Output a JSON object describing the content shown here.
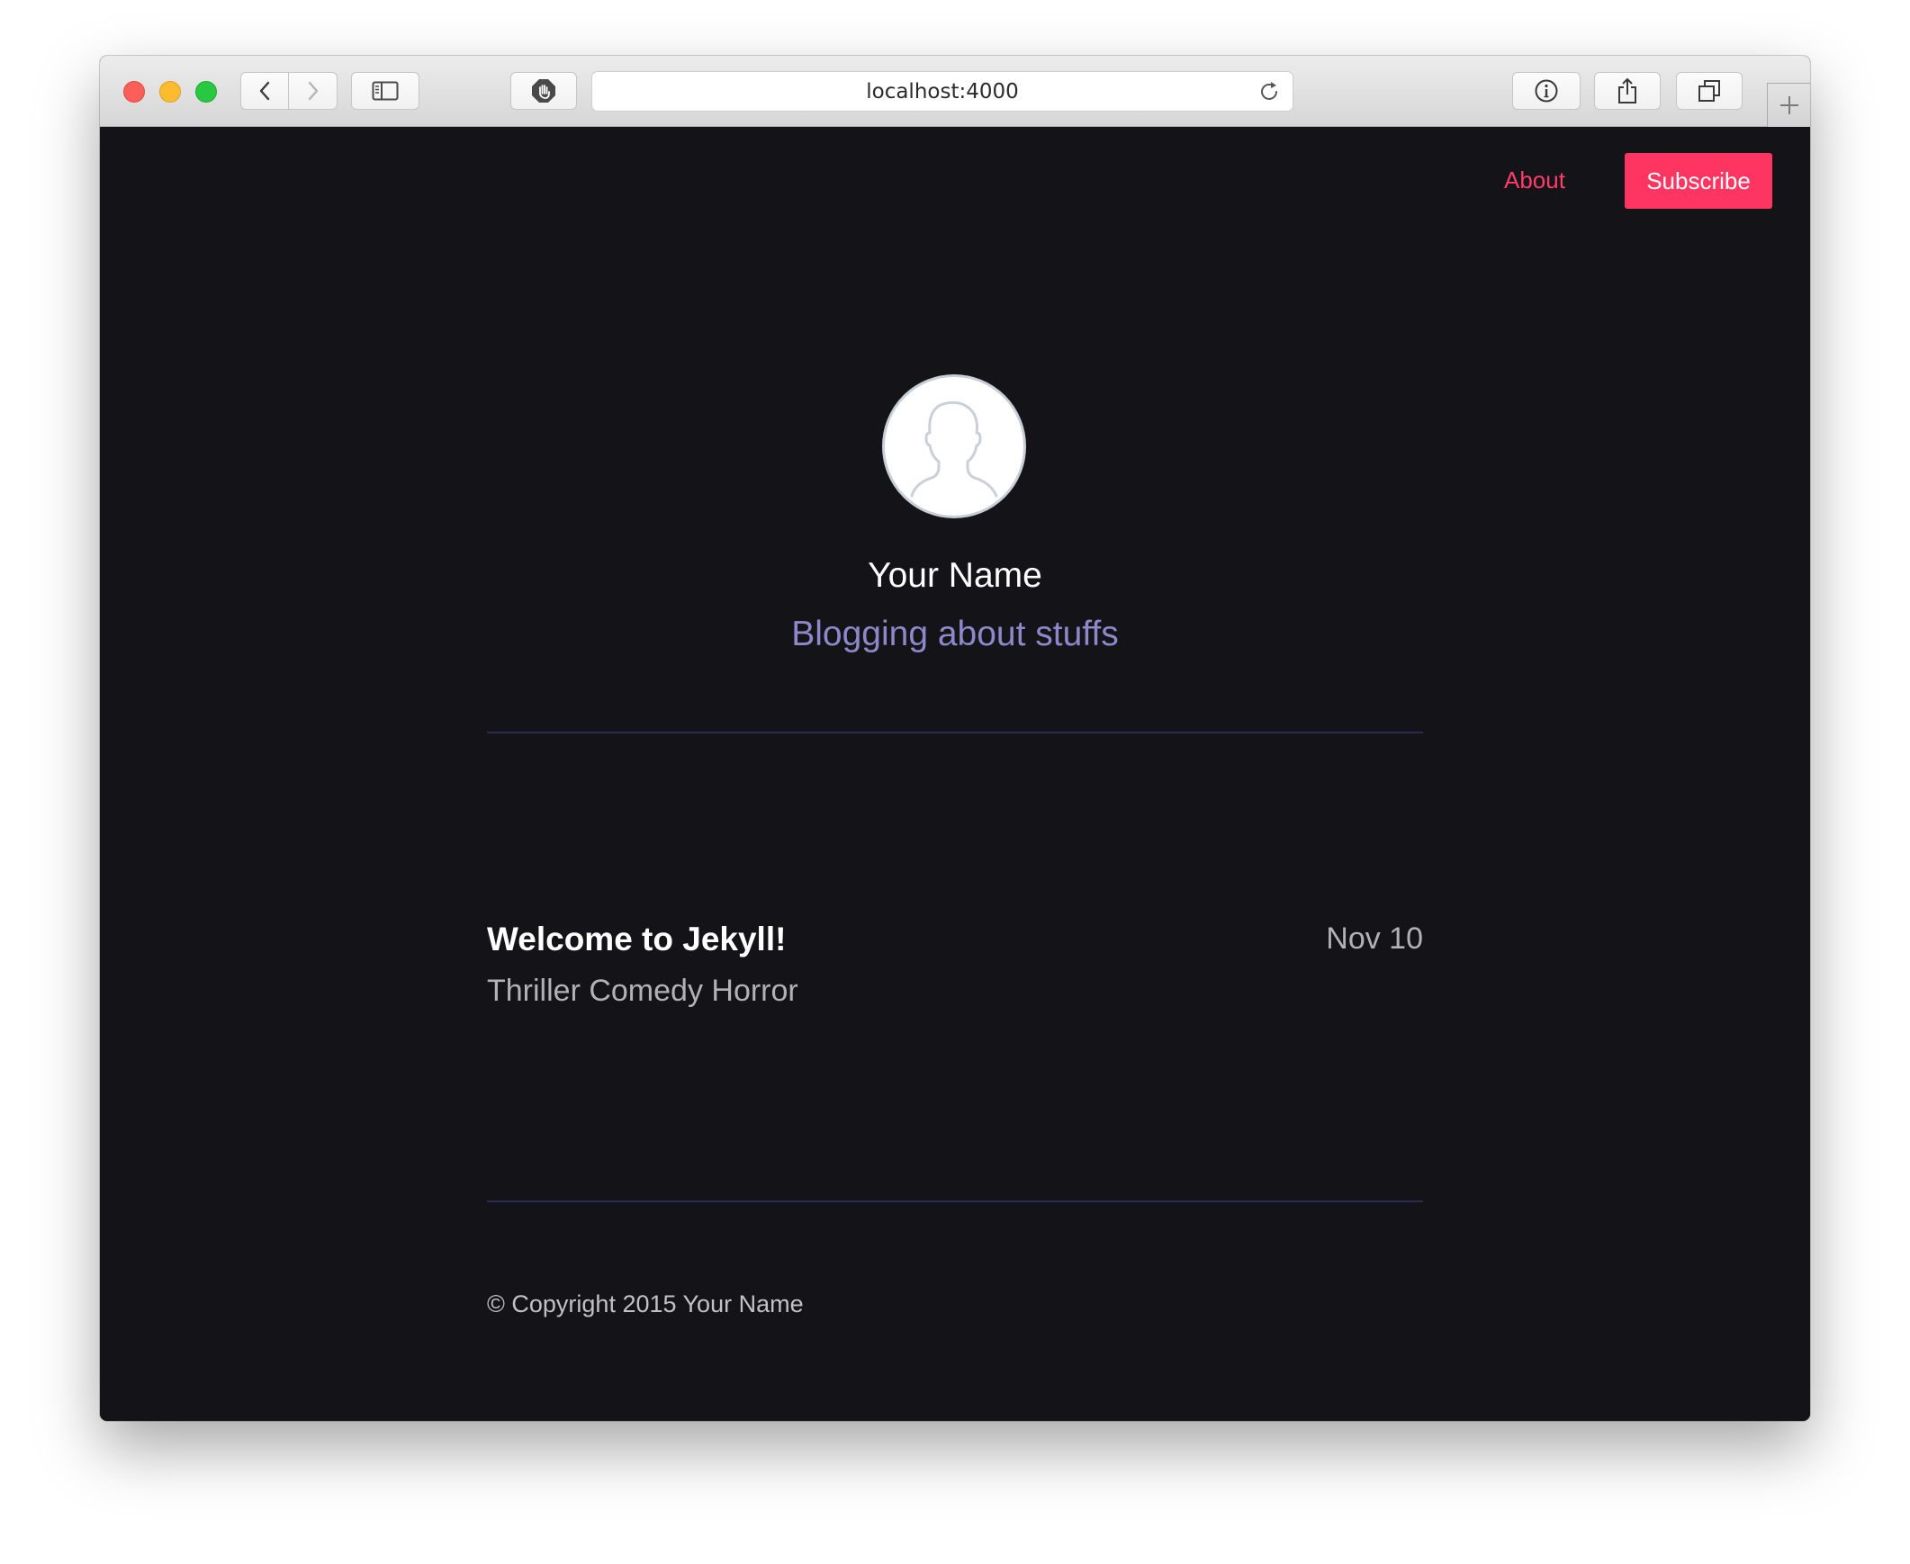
{
  "browser": {
    "url": "localhost:4000",
    "icons": {
      "back": "chevron-left-icon",
      "forward": "chevron-right-icon",
      "sidebar": "sidebar-icon",
      "privacy": "hand-stop-icon",
      "reload": "reload-icon",
      "info": "info-icon",
      "share": "share-icon",
      "tabs": "tabs-overview-icon",
      "new_tab": "plus-icon"
    }
  },
  "nav": {
    "about_label": "About",
    "subscribe_label": "Subscribe"
  },
  "profile": {
    "name": "Your Name",
    "tagline": "Blogging about stuffs"
  },
  "posts": [
    {
      "title": "Welcome to Jekyll!",
      "date": "Nov 10",
      "tags": "Thriller Comedy Horror"
    }
  ],
  "footer": {
    "copyright": "© Copyright 2015 Your Name"
  },
  "colors": {
    "background": "#131318",
    "accent": "#ff3561",
    "tagline": "#8f87c9",
    "divider": "#2d2a55"
  }
}
